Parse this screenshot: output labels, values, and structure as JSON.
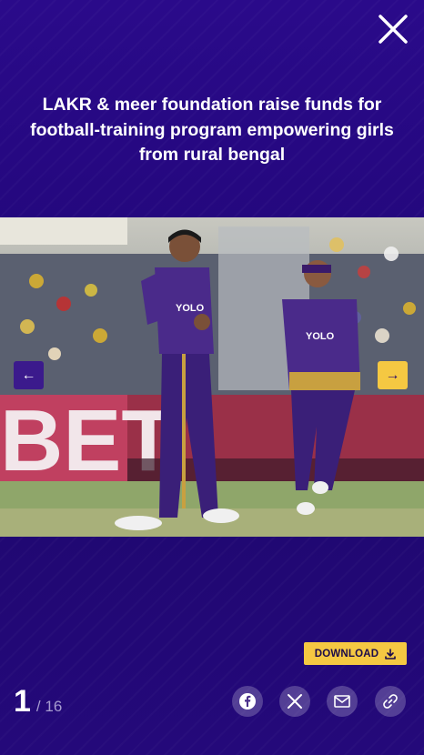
{
  "title": "LAKR & meer foundation raise funds for football-training program empowering girls from rural bengal",
  "gallery": {
    "current": "1",
    "total": "/ 16",
    "image_alt": "Two cricketers in purple and gold kit celebrating on the field",
    "jersey_sponsor": "YOLO",
    "prev_arrow": "←",
    "next_arrow": "→"
  },
  "download_label": "DOWNLOAD",
  "share": {
    "icons": [
      "facebook-icon",
      "x-icon",
      "email-icon",
      "link-icon"
    ]
  },
  "colors": {
    "background": "#250880",
    "accent": "#f5c842",
    "prev_button": "#3b1a8c"
  }
}
